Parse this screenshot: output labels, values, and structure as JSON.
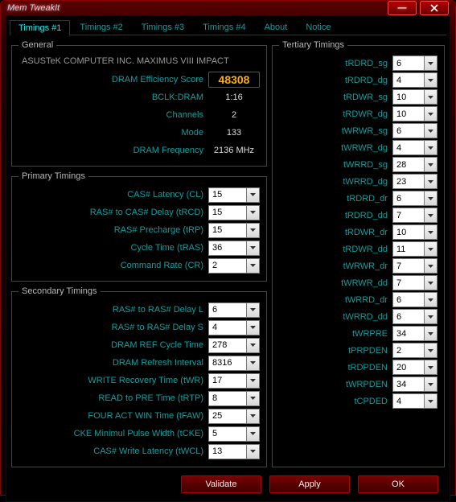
{
  "window": {
    "title": "Mem TweakIt"
  },
  "tabs": [
    "Timings #1",
    "Timings #2",
    "Timings #3",
    "Timings #4",
    "About",
    "Notice"
  ],
  "active_tab": 0,
  "general": {
    "legend": "General",
    "board": "ASUSTeK COMPUTER INC. MAXIMUS VIII IMPACT",
    "rows": [
      {
        "label": "DRAM Efficiency Score",
        "value": "48308",
        "highlight": true
      },
      {
        "label": "BCLK:DRAM",
        "value": "1:16"
      },
      {
        "label": "Channels",
        "value": "2"
      },
      {
        "label": "Mode",
        "value": "133"
      },
      {
        "label": "DRAM Frequency",
        "value": "2136 MHz"
      }
    ]
  },
  "primary": {
    "legend": "Primary Timings",
    "rows": [
      {
        "label": "CAS# Latency (CL)",
        "value": "15"
      },
      {
        "label": "RAS# to CAS# Delay (tRCD)",
        "value": "15"
      },
      {
        "label": "RAS# Precharge (tRP)",
        "value": "15"
      },
      {
        "label": "Cycle Time (tRAS)",
        "value": "36"
      },
      {
        "label": "Command Rate (CR)",
        "value": "2"
      }
    ]
  },
  "secondary": {
    "legend": "Secondary Timings",
    "rows": [
      {
        "label": "RAS# to RAS# Delay L",
        "value": "6"
      },
      {
        "label": "RAS# to RAS# Delay S",
        "value": "4"
      },
      {
        "label": "DRAM REF Cycle Time",
        "value": "278"
      },
      {
        "label": "DRAM Refresh Interval",
        "value": "8316"
      },
      {
        "label": "WRITE Recovery Time (tWR)",
        "value": "17"
      },
      {
        "label": "READ to PRE Time (tRTP)",
        "value": "8"
      },
      {
        "label": "FOUR ACT WIN Time (tFAW)",
        "value": "25"
      },
      {
        "label": "CKE Minimul Pulse Width (tCKE)",
        "value": "5"
      },
      {
        "label": "CAS# Write Latency (tWCL)",
        "value": "13"
      }
    ]
  },
  "tertiary": {
    "legend": "Tertiary Timings",
    "rows": [
      {
        "label": "tRDRD_sg",
        "value": "6"
      },
      {
        "label": "tRDRD_dg",
        "value": "4"
      },
      {
        "label": "tRDWR_sg",
        "value": "10"
      },
      {
        "label": "tRDWR_dg",
        "value": "10"
      },
      {
        "label": "tWRWR_sg",
        "value": "6"
      },
      {
        "label": "tWRWR_dg",
        "value": "4"
      },
      {
        "label": "tWRRD_sg",
        "value": "28"
      },
      {
        "label": "tWRRD_dg",
        "value": "23"
      },
      {
        "label": "tRDRD_dr",
        "value": "6"
      },
      {
        "label": "tRDRD_dd",
        "value": "7"
      },
      {
        "label": "tRDWR_dr",
        "value": "10"
      },
      {
        "label": "tRDWR_dd",
        "value": "11"
      },
      {
        "label": "tWRWR_dr",
        "value": "7"
      },
      {
        "label": "tWRWR_dd",
        "value": "7"
      },
      {
        "label": "tWRRD_dr",
        "value": "6"
      },
      {
        "label": "tWRRD_dd",
        "value": "6"
      },
      {
        "label": "tWRPRE",
        "value": "34"
      },
      {
        "label": "tPRPDEN",
        "value": "2"
      },
      {
        "label": "tRDPDEN",
        "value": "20"
      },
      {
        "label": "tWRPDEN",
        "value": "34"
      },
      {
        "label": "tCPDED",
        "value": "4"
      }
    ]
  },
  "footer": {
    "validate": "Validate",
    "apply": "Apply",
    "ok": "OK"
  }
}
